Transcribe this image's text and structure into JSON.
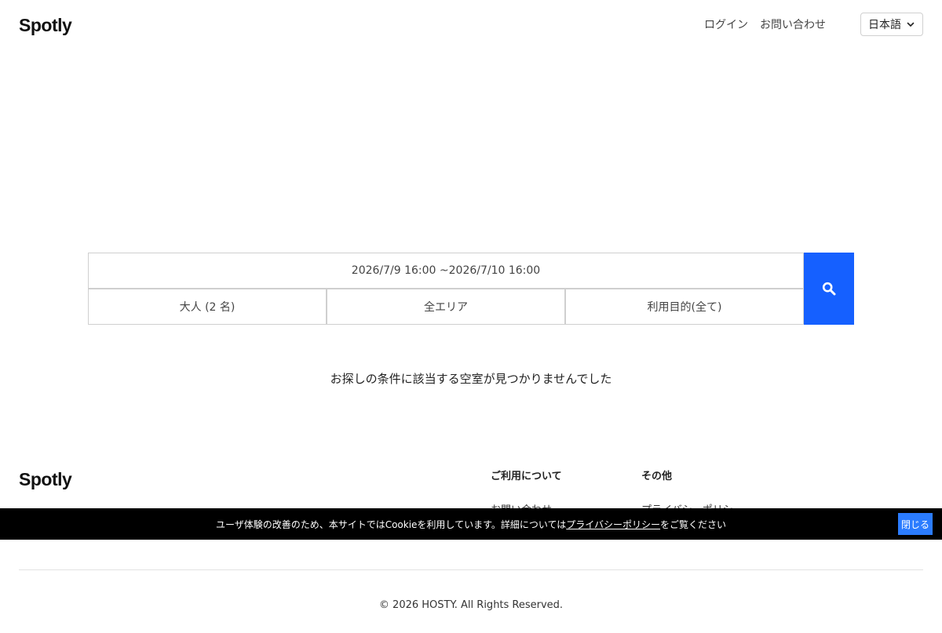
{
  "header": {
    "logo": "Spotly",
    "nav": {
      "login": "ログイン",
      "contact": "お問い合わせ"
    },
    "language": {
      "selected": "日本語",
      "icon": "chevron-down-icon"
    }
  },
  "search": {
    "date_range": "2026/7/9 16:00 ~2026/7/10 16:00",
    "guests": "大人 (2 名)",
    "area": "全エリア",
    "purpose": "利用目的(全て)",
    "button_icon": "search-icon",
    "button_color": "#1560ff"
  },
  "results": {
    "message": "お探しの条件に該当する空室が見つかりませんでした"
  },
  "footer": {
    "logo": "Spotly",
    "sections": [
      {
        "heading": "ご利用について",
        "links": [
          "お問い合わせ"
        ]
      },
      {
        "heading": "その他",
        "links": [
          "プライバシーポリシー"
        ]
      }
    ],
    "copyright": "© 2026 HOSTY. All Rights Reserved."
  },
  "cookie_banner": {
    "text_before": "ユーザ体験の改善のため、本サイトではCookieを利用しています。詳細については",
    "link": "プライバシーポリシー",
    "text_after": "をご覧ください",
    "close_label": "閉じる",
    "close_color": "#2b7cff"
  }
}
